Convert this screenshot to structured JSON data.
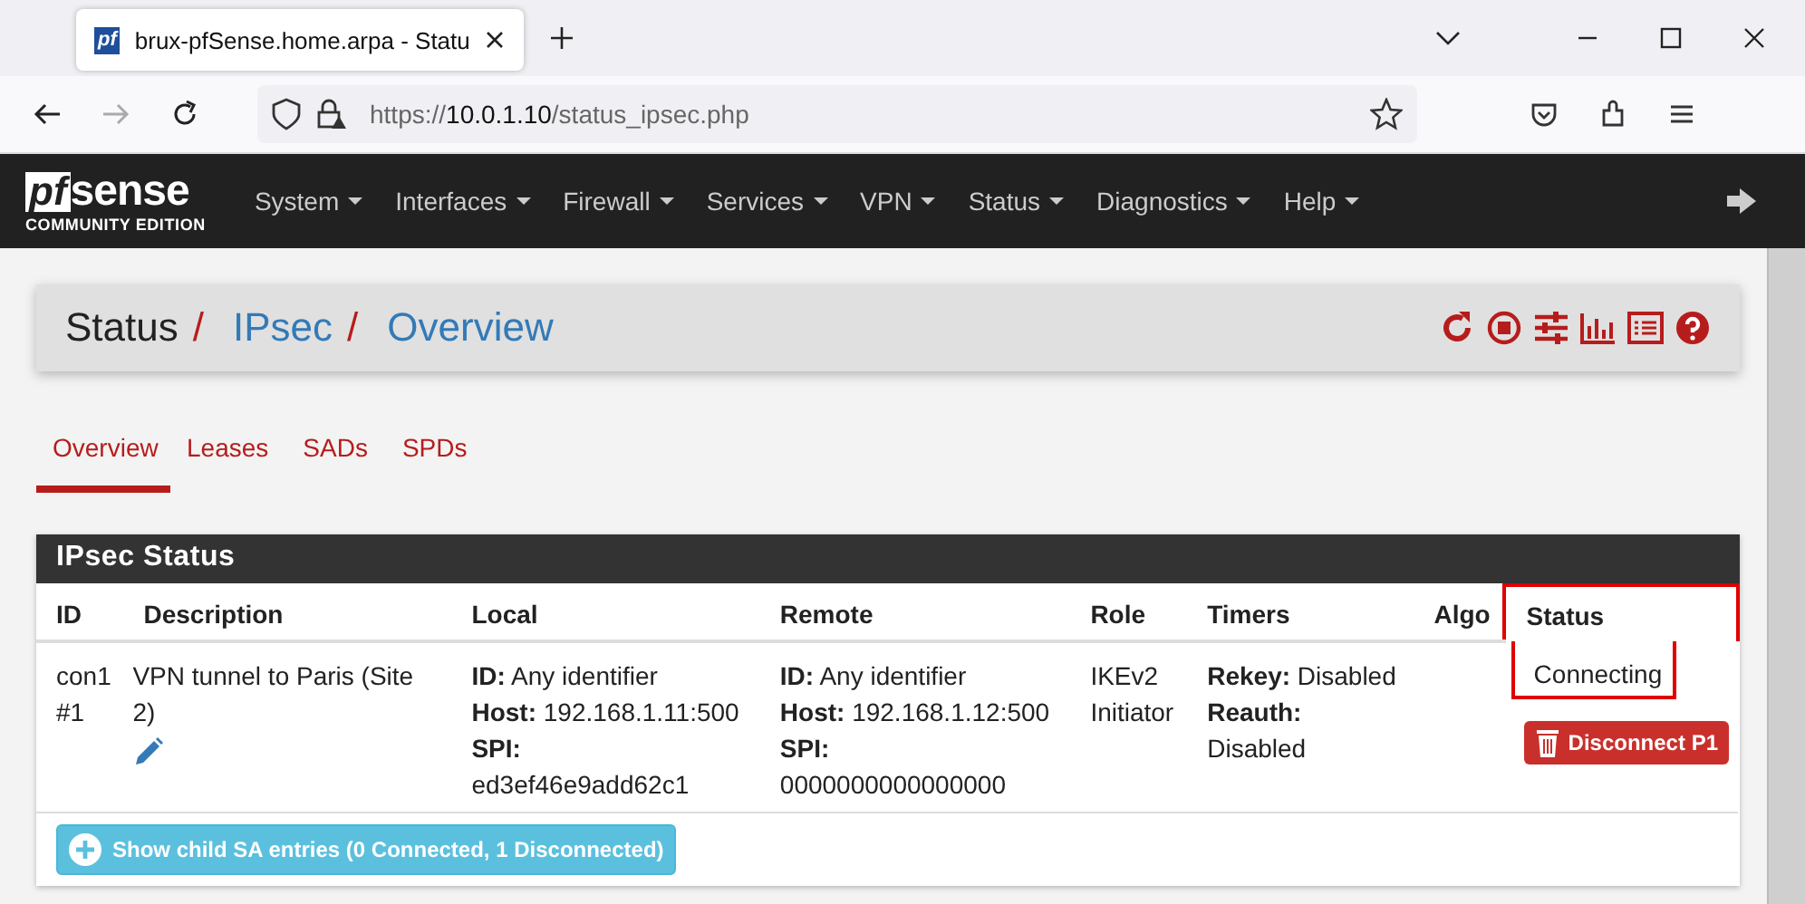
{
  "browser": {
    "favicon_text": "pf",
    "tab_title": "brux-pfSense.home.arpa - Statu",
    "url_prefix": "https://",
    "url_host": "10.0.1.10",
    "url_path": "/status_ipsec.php"
  },
  "navbar": {
    "logo_main": "sense",
    "logo_pf": "pf",
    "logo_sub": "COMMUNITY EDITION",
    "menus": [
      "System",
      "Interfaces",
      "Firewall",
      "Services",
      "VPN",
      "Status",
      "Diagnostics",
      "Help"
    ]
  },
  "breadcrumb": [
    {
      "label": "Status",
      "link": false,
      "separator": "/"
    },
    {
      "label": "IPsec",
      "link": true,
      "separator": "/"
    },
    {
      "label": "Overview",
      "link": true
    }
  ],
  "tabs": [
    {
      "label": "Overview",
      "selected": true
    },
    {
      "label": "Leases",
      "selected": false
    },
    {
      "label": "SADs",
      "selected": false
    },
    {
      "label": "SPDs",
      "selected": false
    }
  ],
  "panel": {
    "title": "IPsec Status",
    "columns": [
      {
        "label": "ID",
        "highlighted": false
      },
      {
        "label": "Description",
        "highlighted": false
      },
      {
        "label": "Local",
        "highlighted": false
      },
      {
        "label": "Remote",
        "highlighted": false
      },
      {
        "label": "Role",
        "highlighted": false
      },
      {
        "label": "Timers",
        "highlighted": false
      },
      {
        "label": "Algo",
        "highlighted": false
      },
      {
        "label": "Status",
        "highlighted": true
      }
    ],
    "rows": [
      {
        "id": [
          "con1",
          "#1"
        ],
        "description": "VPN tunnel to Paris (Site 2)",
        "local": [
          [
            "ID:",
            "Any identifier"
          ],
          [
            "Host:",
            "192.168.1.11:500"
          ],
          [
            "SPI:"
          ]
        ],
        "local_spi": "ed3ef46e9add62c1",
        "remote": [
          [
            "ID:",
            "Any identifier"
          ],
          [
            "Host:",
            "192.168.1.12:500"
          ],
          [
            "SPI:"
          ]
        ],
        "remote_spi": "0000000000000000",
        "role": [
          "IKEv2",
          "Initiator"
        ],
        "timers": [
          [
            "Rekey:",
            "Disabled"
          ],
          [
            "Reauth:"
          ]
        ],
        "timers_extra": "Disabled",
        "status": "Connecting",
        "action": "Disconnect P1"
      }
    ],
    "footer_button": "Show child SA entries (0 Connected, 1 Disconnected)"
  }
}
